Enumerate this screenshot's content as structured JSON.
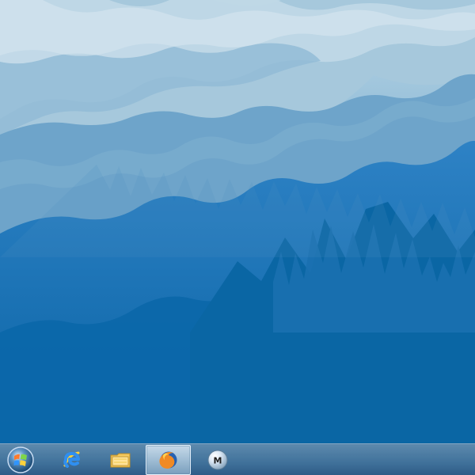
{
  "screen": {
    "name": "Windows desktop"
  },
  "wallpaper": {
    "theme": "blue-sky-and-waterfall",
    "colors": {
      "light": "#b7d3e3",
      "mid": "#6ea4ca",
      "deep": "#0a67a7"
    }
  },
  "taskbar": {
    "items": [
      {
        "name": "start-button",
        "icon": "windows-start-orb-icon"
      },
      {
        "name": "internet-explorer",
        "icon": "internet-explorer-icon"
      },
      {
        "name": "file-explorer",
        "icon": "file-explorer-icon"
      },
      {
        "name": "firefox",
        "icon": "firefox-icon",
        "active": true
      },
      {
        "name": "media-player",
        "icon": "media-player-icon",
        "label": "M"
      }
    ]
  }
}
